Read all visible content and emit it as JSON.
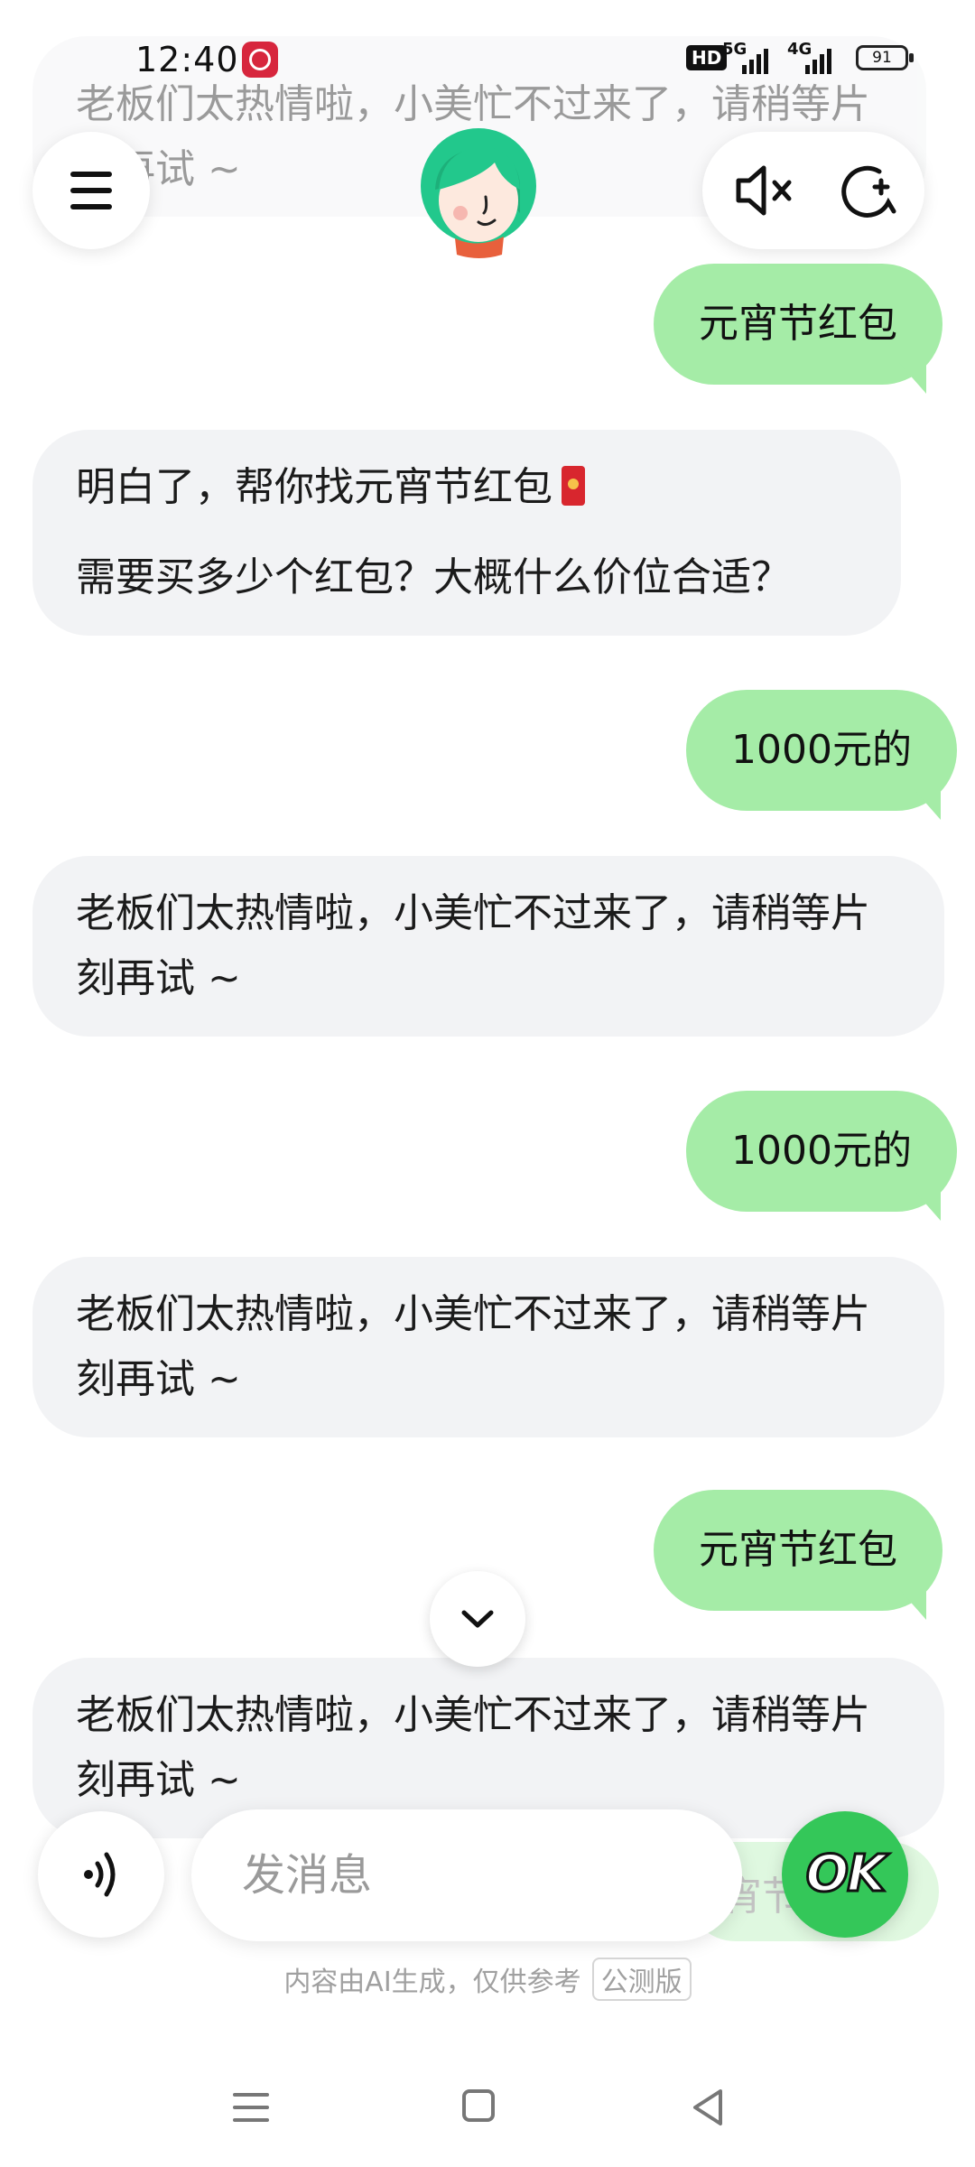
{
  "status_bar": {
    "time": "12:40",
    "hd_label": "HD",
    "signal_5g": "5G",
    "signal_4g": "4G",
    "battery": "91"
  },
  "header": {
    "faded_text": "老板们太热情啦，小美忙不过来了，请稍等片刻再试 ~",
    "menu_icon": "menu-icon",
    "mute_icon": "speaker-muted-icon",
    "new_chat_icon": "new-chat-icon",
    "avatar": "assistant-avatar"
  },
  "messages": [
    {
      "role": "user",
      "text": "元宵节红包"
    },
    {
      "role": "assistant",
      "line1": "明白了，帮你找元宵节红包",
      "line2": "需要买多少个红包？大概什么价位合适？"
    },
    {
      "role": "user",
      "text": "1000元的"
    },
    {
      "role": "assistant",
      "text": "老板们太热情啦，小美忙不过来了，请稍等片刻再试 ~"
    },
    {
      "role": "user",
      "text": "1000元的"
    },
    {
      "role": "assistant",
      "text": "老板们太热情啦，小美忙不过来了，请稍等片刻再试 ~"
    },
    {
      "role": "user",
      "text": "元宵节红包"
    },
    {
      "role": "assistant",
      "text": "老板们太热情啦，小美忙不过来了，请稍等片刻再试 ~"
    }
  ],
  "input": {
    "placeholder": "发消息",
    "ghost_text": "宵节",
    "ok_label": "OK"
  },
  "disclaimer": {
    "text": "内容由AI生成，仅供参考",
    "tag": "公测版"
  },
  "colors": {
    "user_bubble": "#a5eca7",
    "bot_bubble": "#f2f3f5",
    "ok_button": "#34c759"
  }
}
